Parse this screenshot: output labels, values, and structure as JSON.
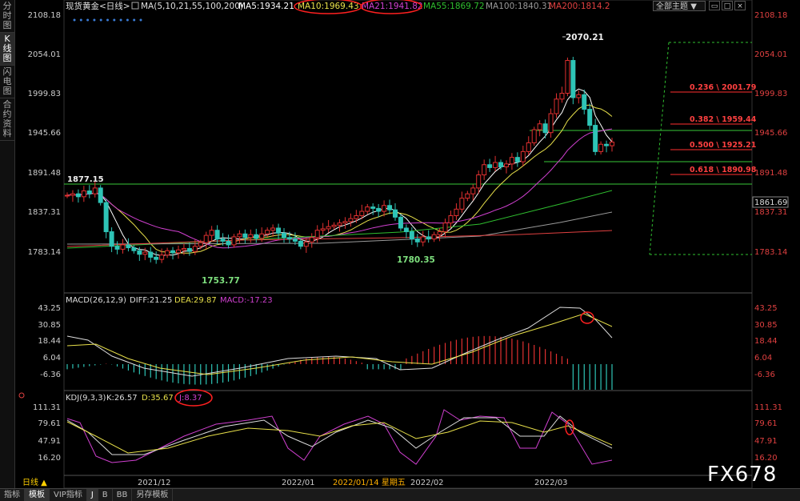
{
  "sidebar": {
    "tabs": [
      {
        "label": "分\n时\n图",
        "active": false
      },
      {
        "label": "K\n线\n图",
        "active": true
      },
      {
        "label": "闪\n电\n图",
        "active": false
      },
      {
        "label": "合\n约\n资\n料",
        "active": false
      }
    ]
  },
  "header": {
    "symbol": "现货黄金<日线>",
    "ma_params": "MA(5,10,21,55,100,200)",
    "ma5": "MA5:1934.21",
    "ma10": "MA10:1969.43",
    "ma21": "MA21:1941.82",
    "ma55": "MA55:1869.72",
    "ma100": "MA100:1840.31",
    "ma200": "MA200:1814.2",
    "theme_select": "全部主题",
    "dropdown_icon": "▼"
  },
  "colors": {
    "up": "#e03030",
    "down": "#2ec4b6",
    "ma5": "#ffffff",
    "ma10": "#e8e04a",
    "ma21": "#d040d0",
    "ma55": "#2fbf2f",
    "ma100": "#9a9a9a",
    "ma200": "#e04040",
    "fib": "#ff3030",
    "hline": "#38c838",
    "red_circle": "#ff2020"
  },
  "price_axis": {
    "left": [
      "2108.18",
      "2054.01",
      "1999.83",
      "1945.66",
      "1891.48",
      "1837.31",
      "1783.14"
    ],
    "right": [
      "2108.18",
      "2054.01",
      "1999.83",
      "1945.66",
      "1891.48",
      "1837.31",
      "1783.14"
    ],
    "current": "1861.69"
  },
  "annotations": {
    "high": "2070.21",
    "low1": "1753.77",
    "low2": "1780.35",
    "level": "1877.15"
  },
  "fib": [
    "0.236 \\ 2001.79",
    "0.382 \\ 1959.44",
    "0.500 \\ 1925.21",
    "0.618 \\ 1890.98"
  ],
  "macd": {
    "label": "MACD(26,12,9)",
    "diff": "DIFF:21.25",
    "dea": "DEA:29.87",
    "macd": "MACD:-17.23",
    "axis": [
      "43.25",
      "30.85",
      "18.44",
      "6.04",
      "-6.36"
    ]
  },
  "kdj": {
    "label": "KDJ(9,3,3)",
    "k": "K:26.57",
    "d": "D:35.67",
    "j": "J:8.37",
    "axis": [
      "111.31",
      "79.61",
      "47.91",
      "16.20"
    ]
  },
  "dates": {
    "d1": "2021/12",
    "d2": "2022/01",
    "d3": "2022/01/14 星期五",
    "d4": "2022/02",
    "d5": "2022/03"
  },
  "period": "日线 ▲",
  "bottom_tabs": [
    "指标",
    "模板",
    "VIP指标",
    "J",
    "B",
    "BB",
    "另存模板"
  ],
  "watermark": "FX678"
}
